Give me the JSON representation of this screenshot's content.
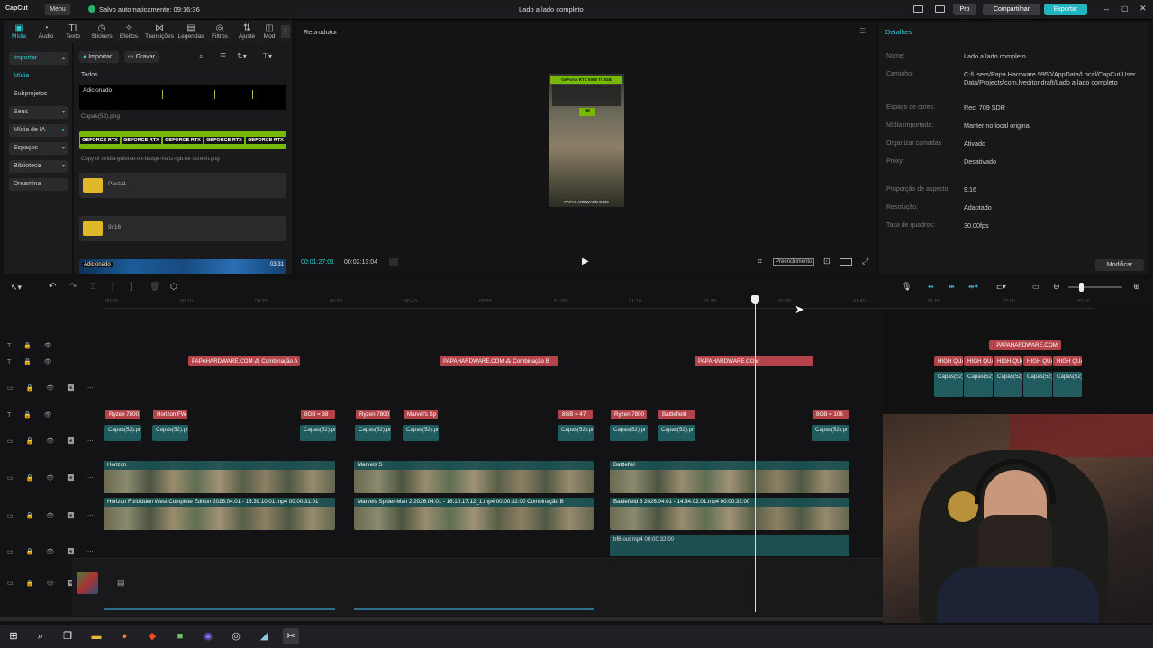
{
  "app": {
    "name": "CapCut",
    "menu": "Menu",
    "autosave": "Salvo automaticamente: 09:16:36",
    "title": "Lado a lado completo",
    "pro": "Pro",
    "share": "Compartilhar",
    "export": "Exportar"
  },
  "toolbar": {
    "tools": [
      {
        "label": "Mídia",
        "icon": "media-icon",
        "glyph": "▣"
      },
      {
        "label": "Áudio",
        "icon": "audio-icon",
        "glyph": "◔"
      },
      {
        "label": "Texto",
        "icon": "text-icon",
        "glyph": "TI"
      },
      {
        "label": "Stickers",
        "icon": "sticker-icon",
        "glyph": "◷"
      },
      {
        "label": "Efeitos",
        "icon": "effects-icon",
        "glyph": "✧"
      },
      {
        "label": "Transições",
        "icon": "transitions-icon",
        "glyph": "⋈"
      },
      {
        "label": "Legendas",
        "icon": "captions-icon",
        "glyph": "▤"
      },
      {
        "label": "Filtros",
        "icon": "filters-icon",
        "glyph": "◎"
      },
      {
        "label": "Ajuste",
        "icon": "adjust-icon",
        "glyph": "⇅"
      },
      {
        "label": "Mod",
        "icon": "template-icon",
        "glyph": "◫"
      }
    ]
  },
  "sidebar": {
    "items": [
      {
        "label": "Importar",
        "active": true
      },
      {
        "label": "Mídia"
      },
      {
        "label": "Subprojetos"
      },
      {
        "label": "Seus"
      },
      {
        "label": "Mídia de IA"
      },
      {
        "label": "Espaços"
      },
      {
        "label": "Biblioteca"
      },
      {
        "label": "Dreamina"
      }
    ]
  },
  "media": {
    "import_btn": "Importar",
    "record_btn": "Gravar",
    "filter_all": "Todos",
    "added_label": "Adicionado",
    "item1_name": "Capas(52).png",
    "badge_text": "GEFORCE RTX",
    "item2_name": "Copy of nvidia-geforce-rtx-badge-horiz-rgb-for-screen.png",
    "folder1": "Pasta1",
    "folder2": "9x16",
    "audio_label": "Adicionado",
    "audio_duration": "03:31"
  },
  "player": {
    "title": "Reprodutor",
    "current_time": "00:01:27:01",
    "total_time": "00:02:13:04",
    "fill_mode": "Preenchimento",
    "preview_header": "GeForce RTX 5060 Ti 8GB",
    "preview_footer": "PAPAHARDWARE.COM",
    "preview_value": "98"
  },
  "details": {
    "title": "Detalhes",
    "rows": [
      {
        "label": "Nome:",
        "value": "Lado a lado completo"
      },
      {
        "label": "Caminho:",
        "value": "C:/Users/Papa Hardware 9950/AppData/Local/CapCut/User Data/Projects/com.lveditor.draft/Lado a lado completo"
      },
      {
        "label": "Espaço de cores:",
        "value": "Rec. 709 SDR"
      },
      {
        "label": "Mídia importada:",
        "value": "Manter no local original"
      },
      {
        "label": "Organizar camadas",
        "value": "Ativado"
      },
      {
        "label": "Proxy:",
        "value": "Desativado"
      },
      {
        "label": "Proporção de aspecto:",
        "value": "9:16"
      },
      {
        "label": "Resolução:",
        "value": "Adaptado"
      },
      {
        "label": "Taxa de quadros:",
        "value": "30.00fps"
      }
    ],
    "modify_btn": "Modificar"
  },
  "ruler": {
    "ticks": [
      "00:00",
      "00:10",
      "00:20",
      "00:30",
      "00:40",
      "00:50",
      "01:00",
      "01:10",
      "01:20",
      "01:30",
      "01:40",
      "01:50",
      "02:00",
      "02:10"
    ]
  },
  "timeline": {
    "text_row": {
      "c1": "PAPAHARDWARE.COM",
      "c1b": "Combinação A",
      "c2": "PAPAHARDWARE.COM",
      "c2b": "Combinação B",
      "c3": "PAPAHARDWARE.COM",
      "c4": "PAPAHARDWARE.COM"
    },
    "labels_row": {
      "a": "Ryzen 7800",
      "b": "Horizon FW",
      "c": "8GB = 38",
      "d": "Ryzen 7800",
      "e": "Marvel's Sp",
      "f": "8GB = 47",
      "g": "Ryzen 7800",
      "h": "Battlefield",
      "i": "8GB = 106",
      "hq": "HIGH QUA"
    },
    "caps_label": "Capas(52).pr",
    "caps_short": "Capas(52)",
    "segment_labels": {
      "horizon": "Horizon",
      "marvels": "Marvels S",
      "battlefield": "Battlefiel"
    },
    "video1": "Horizon Forbidden West Complete Edition 2026.04.01 - 15.39.10.01.mp4  00:00:31:01",
    "video2": "Marvels Spider-Man 2 2026.04.01 - 16.10.17.12_1.mp4  00:00:32:00  Combinação B",
    "video3": "Battlefield 6 2026.04.01 - 14.34.02.01.mp4  00:00:32:00",
    "video4": "bf6 out.mp4  00:00:32:00"
  },
  "taskbar": {
    "apps": [
      "windows-icon",
      "search-icon",
      "taskview-icon",
      "explorer-icon",
      "firefox-icon",
      "brave-icon",
      "app-icon",
      "discord-icon",
      "obs-icon",
      "app2-icon",
      "capcut-icon"
    ]
  },
  "colors": {
    "accent": "#2ecfd4",
    "export": "#21b5c0",
    "clip_red": "#b5444a",
    "clip_teal": "#1f5b5f"
  }
}
